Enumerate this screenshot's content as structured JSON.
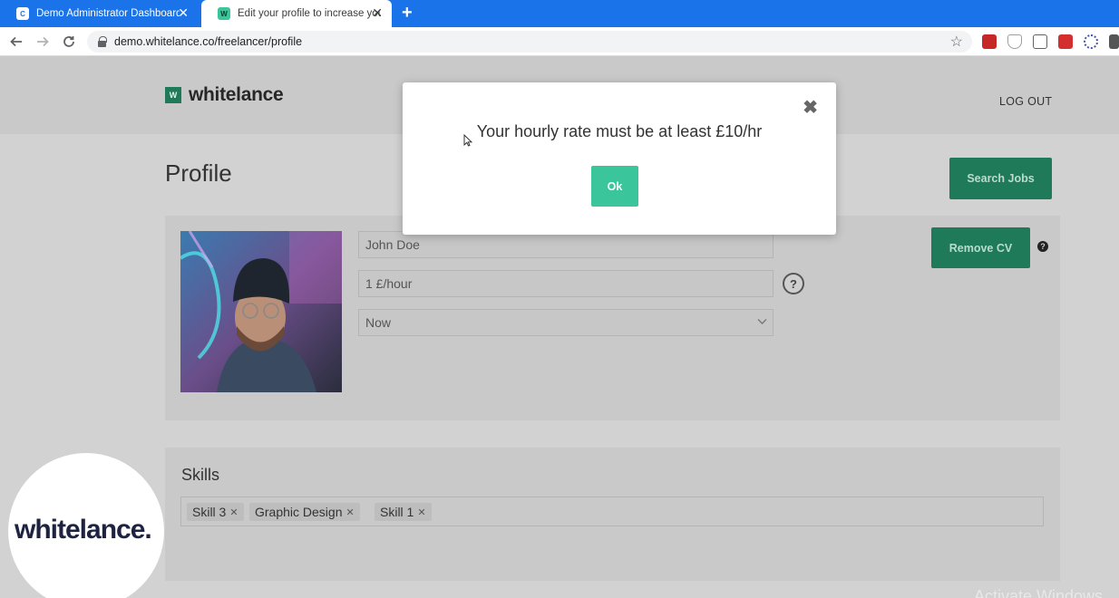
{
  "browser": {
    "tabs": [
      {
        "title": "Demo Administrator Dashboard",
        "favicon": "C"
      },
      {
        "title": "Edit your profile to increase your",
        "favicon": "W"
      }
    ],
    "close_glyph": "✕",
    "new_tab_glyph": "+",
    "url": "demo.whitelance.co/freelancer/profile"
  },
  "header": {
    "logo_mark": "W",
    "logo_text": "whitelance",
    "logout_label": "LOG OUT"
  },
  "profile": {
    "title": "Profile",
    "search_jobs_label": "Search Jobs",
    "remove_cv_label": "Remove CV",
    "name_value": "John Doe",
    "rate_value": "1 £/hour",
    "availability_value": "Now",
    "help_glyph": "?"
  },
  "skills": {
    "title": "Skills",
    "chips": [
      "Skill 3",
      "Graphic Design",
      "Skill 1"
    ],
    "remove_glyph": "✕"
  },
  "watermark": {
    "text": "whitelance.",
    "activate_text": "Activate Windows"
  },
  "modal": {
    "message": "Your hourly rate must be at least £10/hr",
    "ok_label": "Ok",
    "close_glyph": "✖"
  },
  "colors": {
    "chrome_blue": "#1a73e8",
    "brand_green": "#3ac59a",
    "dark_green": "#1f7a5a"
  },
  "icons": [
    "back-arrow-icon",
    "forward-arrow-icon",
    "reload-icon",
    "lock-icon",
    "star-icon",
    "help-icon",
    "close-icon",
    "chevron-down-icon"
  ]
}
